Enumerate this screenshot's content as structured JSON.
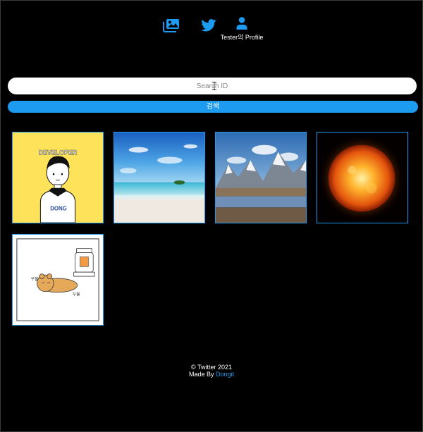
{
  "nav": {
    "gallery_icon": "images-icon",
    "twitter_icon": "twitter-bird-icon",
    "profile_icon": "user-icon",
    "profile_label": "Tester의 Profile"
  },
  "search": {
    "placeholder": "Search ID",
    "button_label": "검색"
  },
  "gallery": {
    "items": [
      {
        "subject": "developer-character",
        "caption": "DEVELOPER",
        "shirt_text": "DONG"
      },
      {
        "subject": "beach-sky"
      },
      {
        "subject": "mountain-lake"
      },
      {
        "subject": "sun"
      },
      {
        "subject": "cartoon-bear-heater",
        "labels": [
          "꾸물",
          "꾸물"
        ]
      }
    ]
  },
  "footer": {
    "copyright": "© Twitter 2021",
    "made_by": "Made By",
    "author": "Dongit"
  },
  "colors": {
    "accent": "#1d9bf0",
    "background": "#000000"
  }
}
